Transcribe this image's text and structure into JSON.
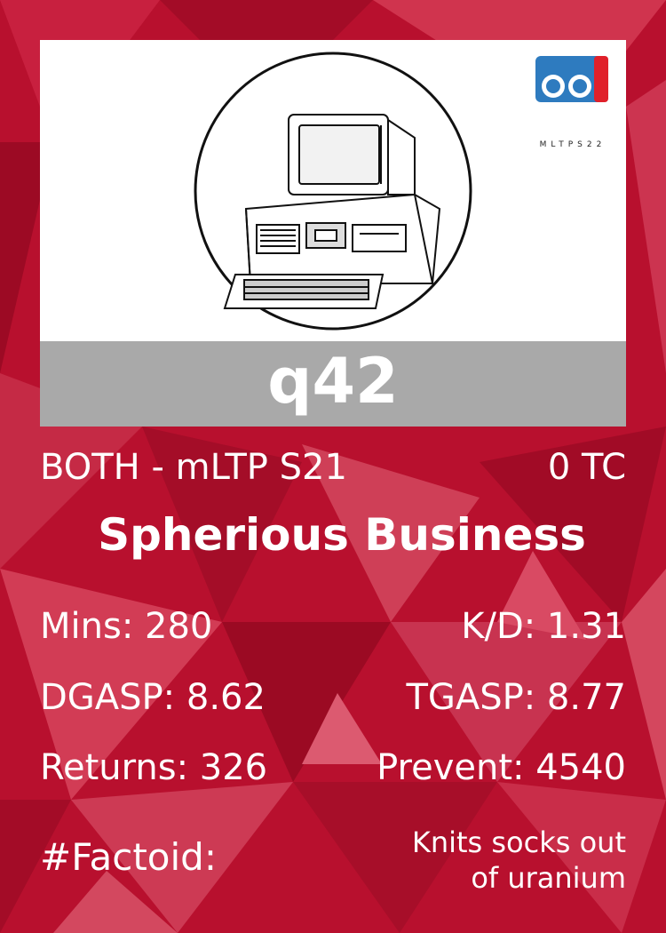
{
  "player": {
    "name": "q42"
  },
  "logo": {
    "text": "MLTPS22"
  },
  "header": {
    "league": "BOTH - mLTP S21",
    "tc": "0 TC"
  },
  "team": {
    "name": "Spherious Business"
  },
  "stats": {
    "mins": "Mins: 280",
    "kd": "K/D: 1.31",
    "dgasp": "DGASP: 8.62",
    "tgasp": "TGASP: 8.77",
    "returns": "Returns: 326",
    "prevent": "Prevent: 4540"
  },
  "factoid": {
    "label": "#Factoid:",
    "line1": "Knits socks out",
    "line2": "of uranium"
  },
  "colors": {
    "background": "#b8102e",
    "name_bar": "#a9a9a9",
    "logo_blue": "#2e7bbf",
    "logo_red": "#e0202a"
  }
}
